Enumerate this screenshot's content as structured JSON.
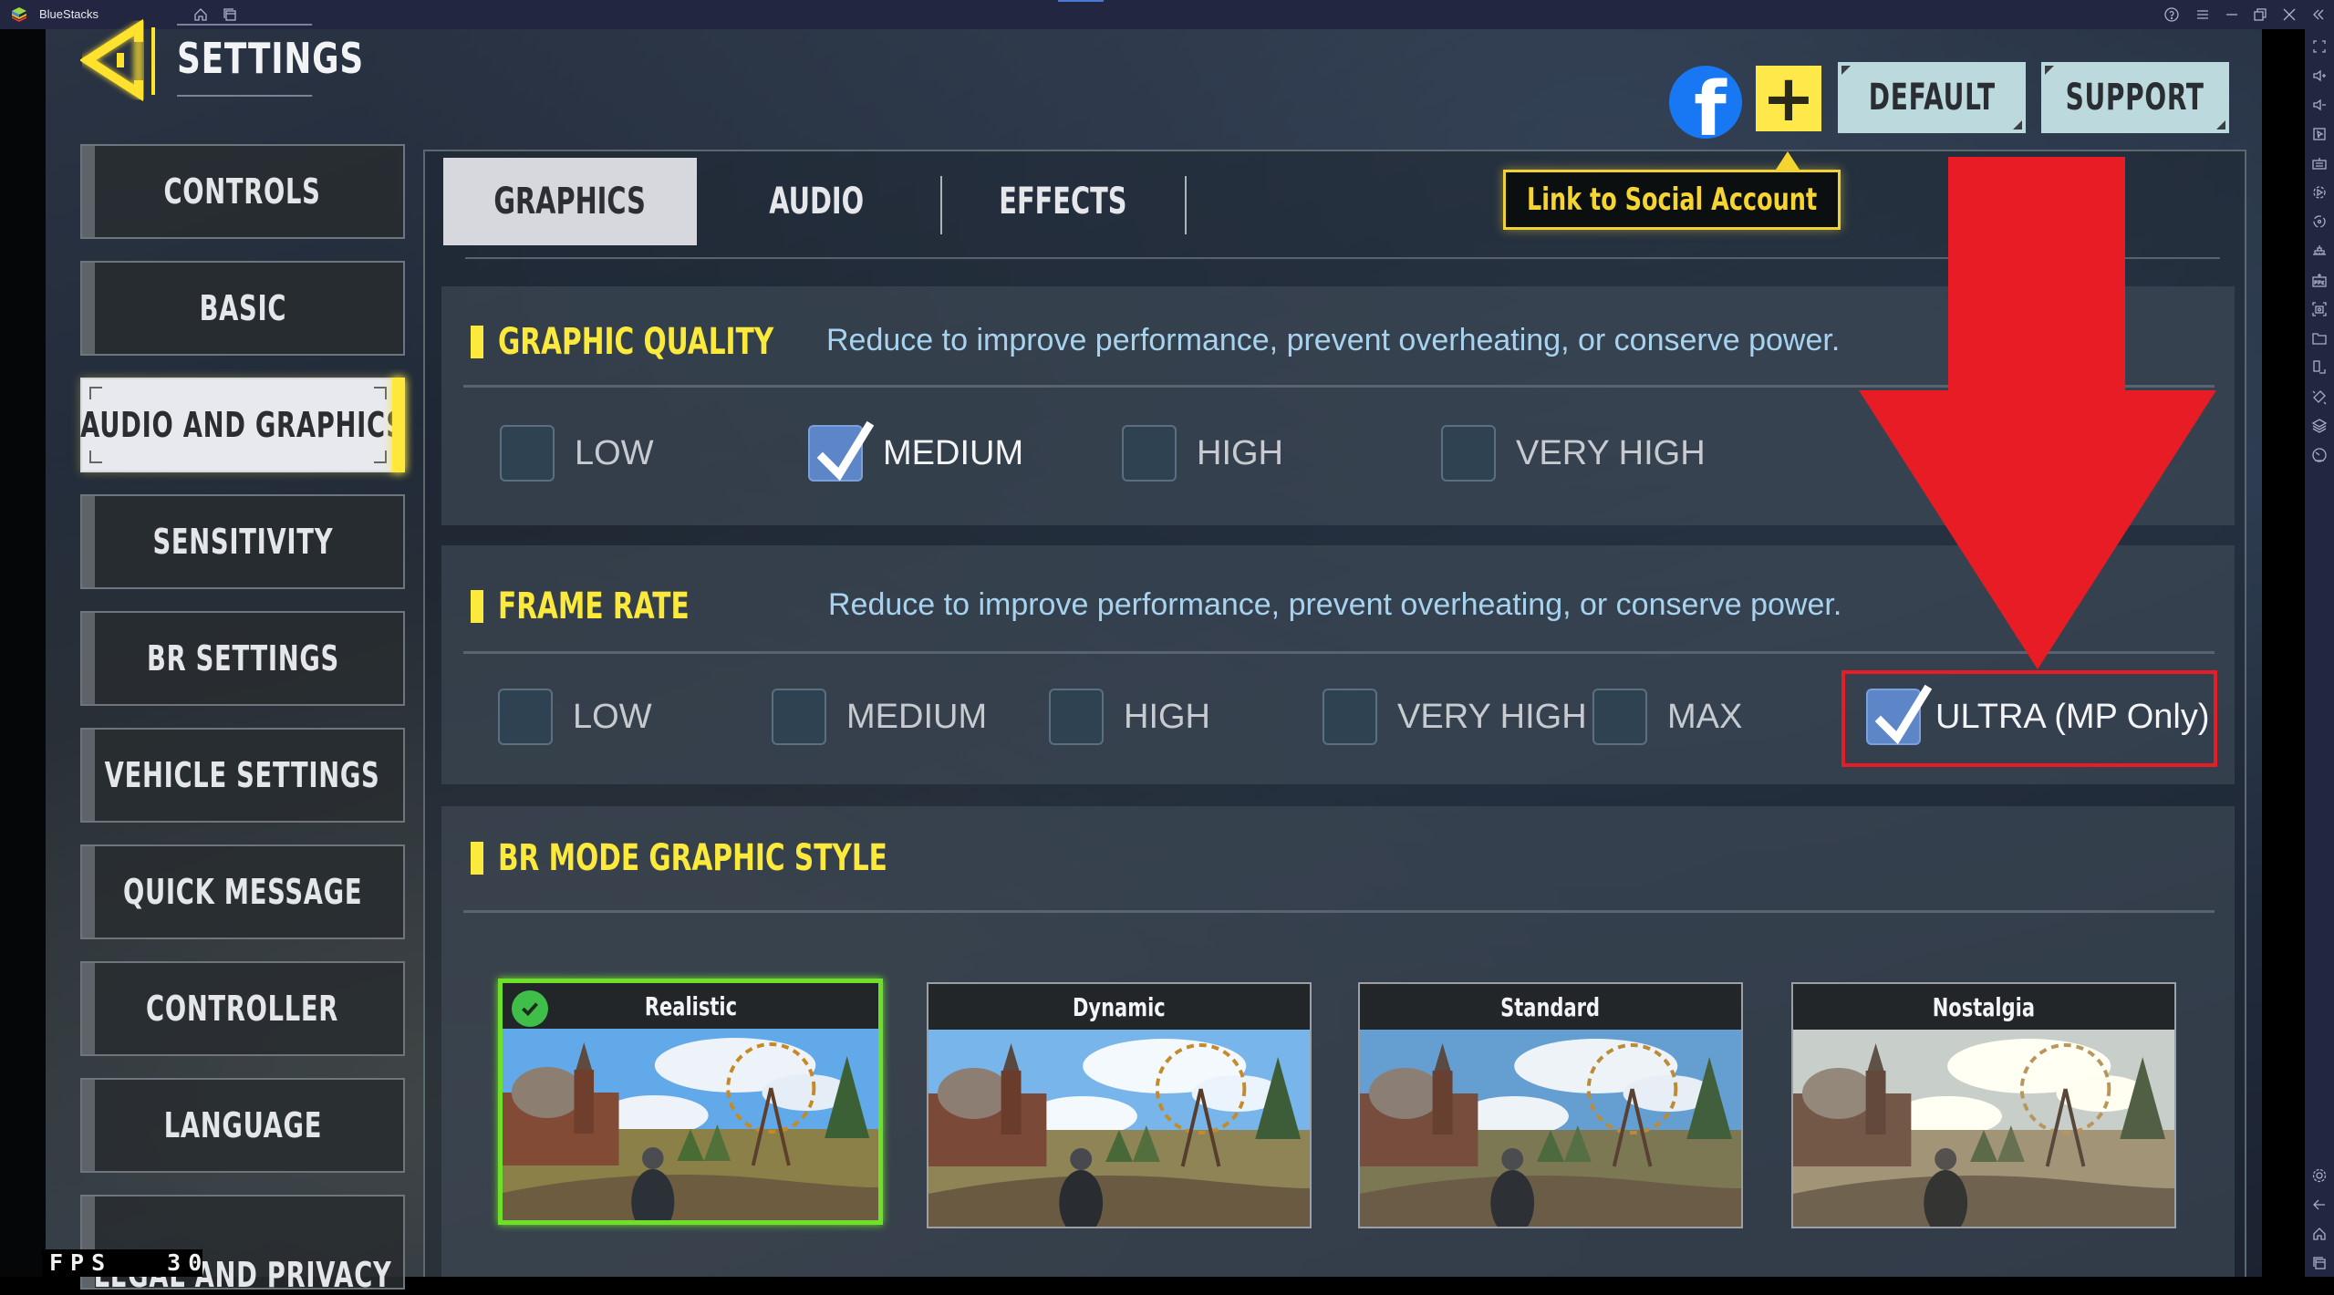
{
  "window": {
    "app_name": "BlueStacks",
    "titlebar_icons": [
      "home-icon",
      "multi-instance-icon",
      "help-icon",
      "menu-icon",
      "minimize-icon",
      "restore-icon",
      "close-icon",
      "collapse-sidebar-icon"
    ]
  },
  "right_toolbar": {
    "icons": [
      "fullscreen-icon",
      "volume-up-icon",
      "volume-down-icon",
      "cursor-icon",
      "keyboard-icon",
      "macro-record-icon",
      "sync-icon",
      "performance-icon",
      "install-apk-icon",
      "screenshot-icon",
      "folder-icon",
      "rotate-icon",
      "shake-icon",
      "layers-icon",
      "eco-mode-icon"
    ],
    "bottom_icons": [
      "settings-icon",
      "back-icon",
      "home-icon",
      "recent-apps-icon"
    ]
  },
  "header": {
    "title": "SETTINGS",
    "default_label": "DEFAULT",
    "support_label": "SUPPORT",
    "facebook_glyph": "f",
    "plus_glyph": "+",
    "tooltip": "Link to Social Account"
  },
  "sidebar": {
    "items": [
      {
        "label": "CONTROLS",
        "active": false
      },
      {
        "label": "BASIC",
        "active": false
      },
      {
        "label": "AUDIO AND GRAPHICS",
        "active": true
      },
      {
        "label": "SENSITIVITY",
        "active": false
      },
      {
        "label": "BR SETTINGS",
        "active": false
      },
      {
        "label": "VEHICLE SETTINGS",
        "active": false
      },
      {
        "label": "QUICK MESSAGE",
        "active": false
      },
      {
        "label": "CONTROLLER",
        "active": false
      },
      {
        "label": "LANGUAGE",
        "active": false
      },
      {
        "label": "LEGAL AND PRIVACY",
        "active": false
      }
    ]
  },
  "tabs": [
    {
      "label": "GRAPHICS",
      "active": true
    },
    {
      "label": "AUDIO",
      "active": false
    },
    {
      "label": "EFFECTS",
      "active": false
    }
  ],
  "graphic_quality": {
    "title": "GRAPHIC QUALITY",
    "description": "Reduce to improve performance, prevent overheating, or conserve power.",
    "options": [
      {
        "label": "LOW",
        "checked": false
      },
      {
        "label": "MEDIUM",
        "checked": true
      },
      {
        "label": "HIGH",
        "checked": false
      },
      {
        "label": "VERY HIGH",
        "checked": false
      }
    ]
  },
  "frame_rate": {
    "title": "FRAME RATE",
    "description": "Reduce to improve performance, prevent overheating, or conserve power.",
    "options": [
      {
        "label": "LOW",
        "checked": false
      },
      {
        "label": "MEDIUM",
        "checked": false
      },
      {
        "label": "HIGH",
        "checked": false
      },
      {
        "label": "VERY HIGH",
        "checked": false
      },
      {
        "label": "MAX",
        "checked": false
      },
      {
        "label": "ULTRA (MP Only)",
        "checked": true
      }
    ]
  },
  "br_mode": {
    "title": "BR MODE GRAPHIC STYLE",
    "styles": [
      {
        "label": "Realistic",
        "selected": true
      },
      {
        "label": "Dynamic",
        "selected": false
      },
      {
        "label": "Standard",
        "selected": false
      },
      {
        "label": "Nostalgia",
        "selected": false
      }
    ]
  },
  "fps_counter": {
    "label": "FPS",
    "value": "30"
  },
  "colors": {
    "accent_yellow": "#fbe93c",
    "selected_green": "#6fe02a",
    "annotation_red": "#e81c24",
    "checkbox_blue": "#5d86c9",
    "facebook_blue": "#1877f2"
  }
}
